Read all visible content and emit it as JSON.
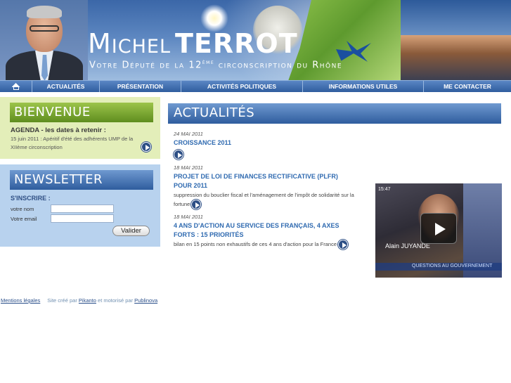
{
  "header": {
    "first_name": "Michel",
    "last_name": "TERROT",
    "subtitle_before": "Votre Député de la 12",
    "subtitle_sup": "ème",
    "subtitle_after": " circonscription du Rhône"
  },
  "nav": {
    "home_icon": "home-icon",
    "items": [
      "ACTUALITÉS",
      "PRÉSENTATION",
      "ACTIVITÉS POLITIQUES",
      "INFORMATIONS UTILES",
      "ME CONTACTER"
    ]
  },
  "welcome": {
    "heading": "BIENVENUE",
    "agenda_title": "AGENDA - les dates à retenir :",
    "agenda_text": "15 juin 2011 : Apéritif d'été des adhérents UMP de la XIIème circonscription"
  },
  "newsletter": {
    "heading": "NEWSLETTER",
    "subscribe": "S'INSCRIRE :",
    "name_label": "votre nom",
    "email_label": "Votre email",
    "name_value": "",
    "email_value": "",
    "submit": "Valider"
  },
  "main": {
    "heading": "ACTUALITÉS",
    "articles": [
      {
        "date": "24 MAI 2011",
        "title": "CROISSANCE 2011",
        "desc": ""
      },
      {
        "date": "18 MAI 2011",
        "title": "PROJET DE LOI DE FINANCES RECTIFICATIVE (PLFR) POUR 2011",
        "desc": "suppression du bouclier fiscal et l'aménagement de l'impôt de solidarité sur la fortune"
      },
      {
        "date": "18 MAI 2011",
        "title": "4 ANS D'ACTION AU SERVICE DES FRANÇAIS, 4 AXES FORTS : 15 PRIORITÉS",
        "desc": "bilan en 15 points non exhaustifs de ces 4 ans d'action pour la France"
      }
    ]
  },
  "video": {
    "time": "15:47",
    "caption": "Alain JUYANDE",
    "ticker": "QUESTIONS AU GOUVERNEMENT"
  },
  "footer": {
    "legal": "Mentions légales",
    "site_by": "Site créé par",
    "creator": "Pikanto",
    "powered_by": "et motorisé par",
    "engine": "Publinova"
  },
  "colors": {
    "nav_blue": "#2f5d9e",
    "title_link": "#2f6ab0",
    "welcome_green": "#5f8d1f",
    "welcome_bg": "#e3eeb9",
    "newsletter_bg": "#b8d2ee"
  }
}
